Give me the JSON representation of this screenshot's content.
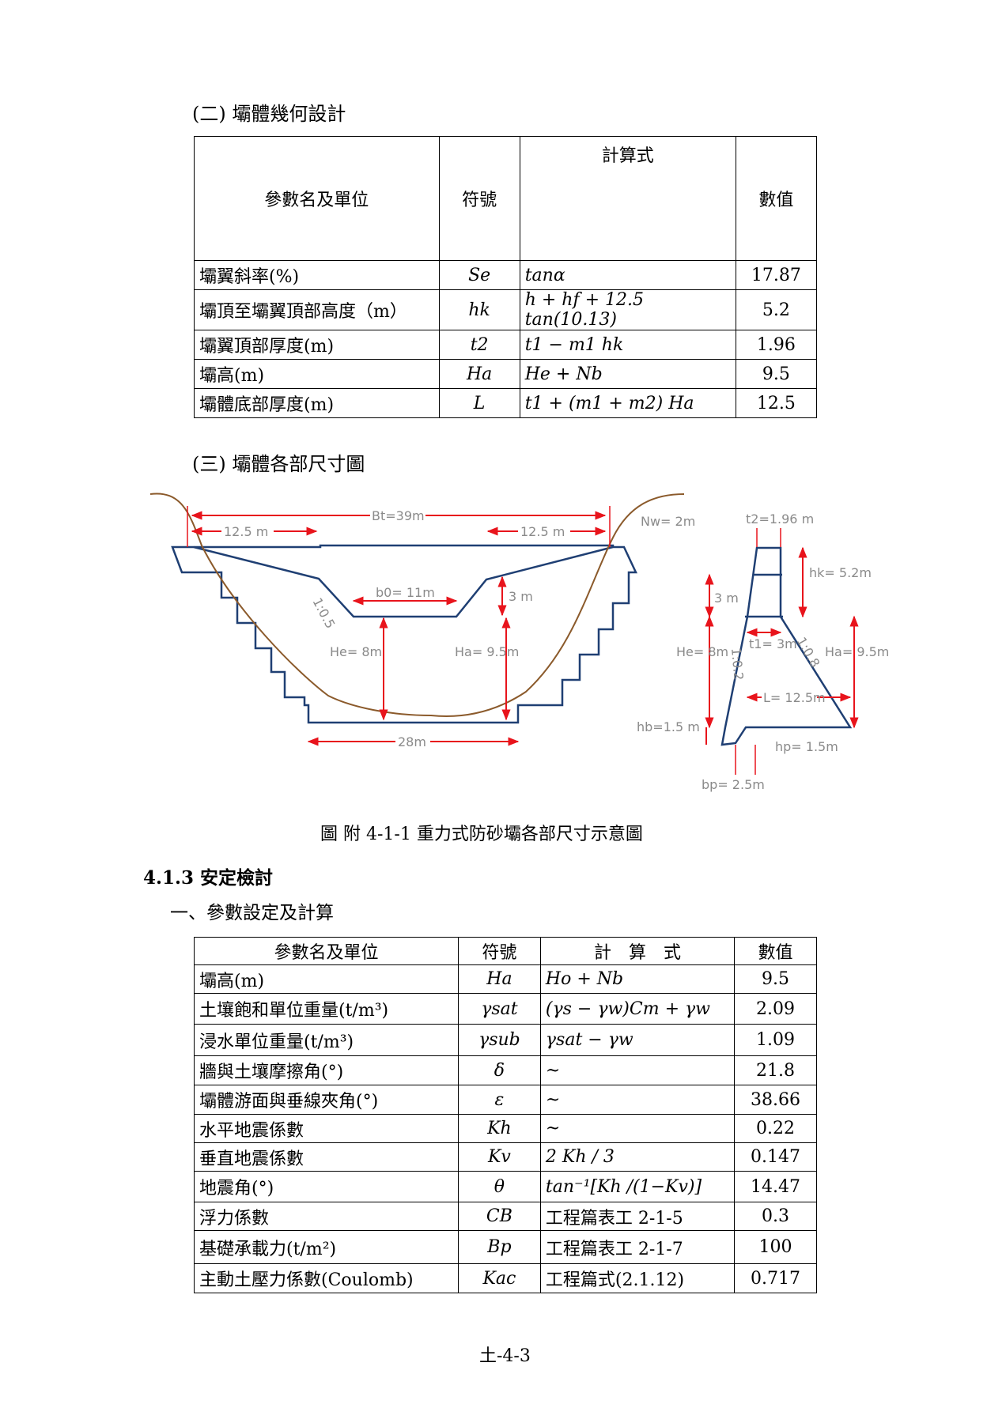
{
  "section2_title": "(二) 壩體幾何設計",
  "table1": {
    "headers": [
      "參數名及單位",
      "符號",
      "計算式",
      "數值"
    ],
    "rows": [
      {
        "param": "壩翼斜率(%)",
        "symbol": "Se",
        "formula": "tanα",
        "value": "17.87"
      },
      {
        "param": "壩頂至壩翼頂部高度（m）",
        "symbol": "hk",
        "formula": "h + hf + 12.5 tan(10.13)",
        "value": "5.2"
      },
      {
        "param": "壩翼頂部厚度(m)",
        "symbol": "t2",
        "formula": "t1 − m1 hk",
        "value": "1.96"
      },
      {
        "param": "壩高(m)",
        "symbol": "Ha",
        "formula": "He + Nb",
        "value": "9.5"
      },
      {
        "param": "壩體底部厚度(m)",
        "symbol": "L",
        "formula": "t1 + (m1 + m2) Ha",
        "value": "12.5"
      }
    ]
  },
  "section3_title": "(三) 壩體各部尺寸圖",
  "diagram": {
    "bt": "Bt=39m",
    "left_wing": "12.5 m",
    "right_wing": "12.5 m",
    "nw": "Nw= 2m",
    "b0": "b0= 11m",
    "notch_depth": "3 m",
    "slope_front": "1:0.5",
    "he": "He= 8m",
    "ha": "Ha= 9.5m",
    "base": "28m",
    "sec_t2": "t2=1.96 m",
    "sec_hk": "hk= 5.2m",
    "sec_3m": "3 m",
    "sec_t1": "t1= 3m",
    "sec_m2": "1:0.8",
    "sec_m1": "1:0.2",
    "sec_he": "He= 8m",
    "sec_ha": "Ha= 9.5m",
    "sec_L": "L= 12.5m",
    "sec_hb": "hb=1.5 m",
    "sec_hp": "hp= 1.5m",
    "sec_bp": "bp= 2.5m",
    "colors": {
      "dim": "#e8141c",
      "structure": "#1f3f73",
      "ground": "#8b5a2b"
    }
  },
  "figure_caption": "圖  附 4-1-1 重力式防砂壩各部尺寸示意圖",
  "section413_title": "4.1.3  安定檢討",
  "subsection1_title": "一、參數設定及計算",
  "table2": {
    "headers": [
      "參數名及單位",
      "符號",
      "計　算　式",
      "數值"
    ],
    "rows": [
      {
        "param": "壩高(m)",
        "symbol": "Ha",
        "formula": "Ho + Nb",
        "value": "9.5"
      },
      {
        "param": "土壤飽和單位重量(t/m³)",
        "symbol": "γsat",
        "formula": "(γs − γw)Cm + γw",
        "value": "2.09"
      },
      {
        "param": "浸水單位重量(t/m³)",
        "symbol": "γsub",
        "formula": "γsat − γw",
        "value": "1.09"
      },
      {
        "param": "牆與土壤摩擦角(°)",
        "symbol": "δ",
        "formula": "~",
        "value": "21.8"
      },
      {
        "param": "壩體游面與垂線夾角(°)",
        "symbol": "ε",
        "formula": "~",
        "value": "38.66"
      },
      {
        "param": "水平地震係數",
        "symbol": "Kh",
        "formula": "~",
        "value": "0.22"
      },
      {
        "param": "垂直地震係數",
        "symbol": "Kv",
        "formula": "2 Kh / 3",
        "value": "0.147"
      },
      {
        "param": "地震角(°)",
        "symbol": "θ",
        "formula": "tan⁻¹[Kh /(1−Kv)]",
        "value": "14.47"
      },
      {
        "param": "浮力係數",
        "symbol": "CB",
        "formula": "工程篇表工 2-1-5",
        "value": "0.3"
      },
      {
        "param": "基礎承載力(t/m²)",
        "symbol": "Bp",
        "formula": "工程篇表工 2-1-7",
        "value": "100"
      },
      {
        "param": "主動土壓力係數(Coulomb)",
        "symbol": "Kac",
        "formula": "工程篇式(2.1.12)",
        "value": "0.717"
      }
    ]
  },
  "page_number": "土-4-3"
}
